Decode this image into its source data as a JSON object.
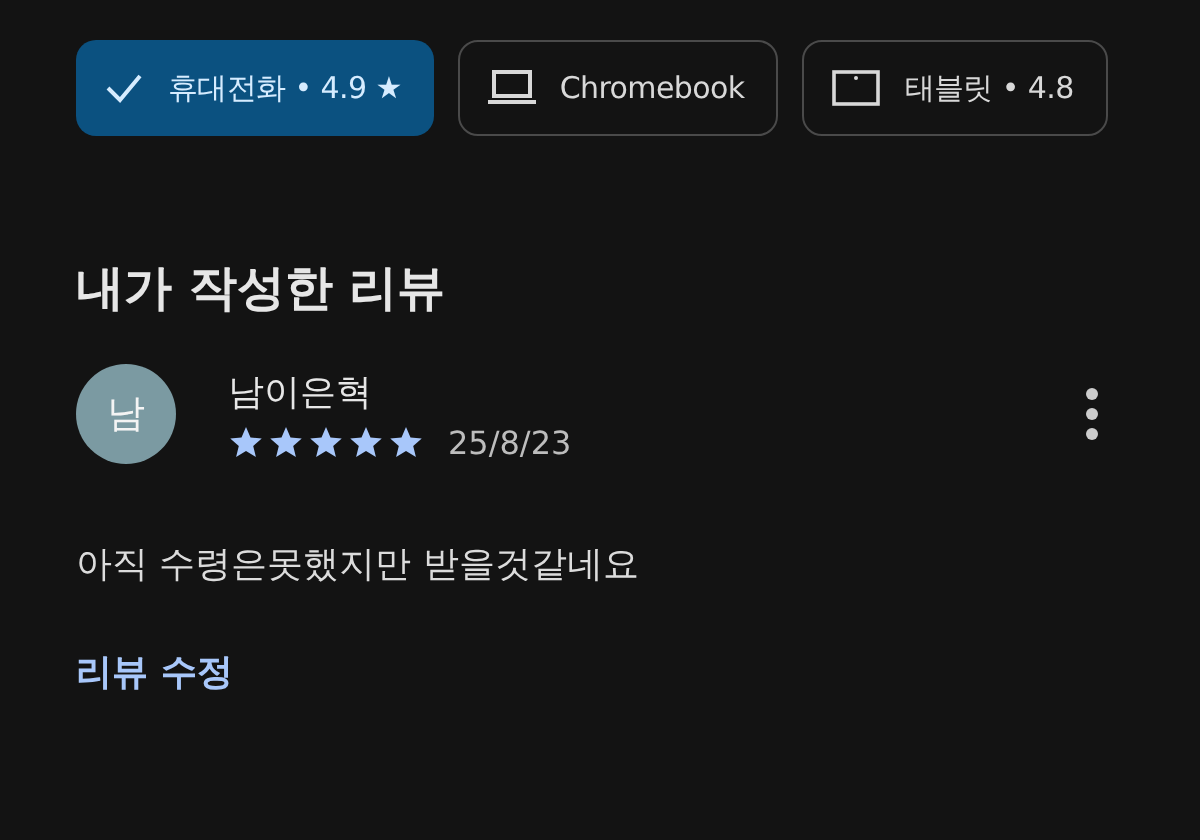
{
  "device_chips": [
    {
      "kind": "check",
      "label": "휴대전화 • 4.9",
      "star": "★",
      "selected": true
    },
    {
      "kind": "laptop",
      "label": "Chromebook",
      "selected": false
    },
    {
      "kind": "tablet",
      "label": "태블릿 • 4.8",
      "selected": false
    }
  ],
  "section_title": "내가 작성한 리뷰",
  "review": {
    "avatar": "남",
    "author": "남이은혁",
    "stars": 5,
    "date": "25/8/23",
    "text": "아직 수령은못했지만 받을것같네요",
    "edit_link": "리뷰 수정"
  }
}
